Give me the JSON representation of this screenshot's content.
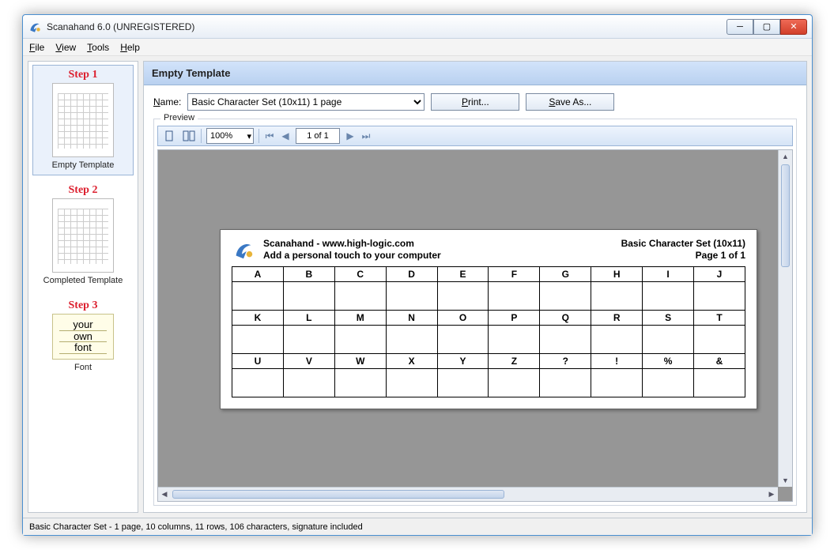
{
  "window": {
    "title": "Scanahand 6.0 (UNREGISTERED)"
  },
  "menubar": {
    "file": "File",
    "view": "View",
    "tools": "Tools",
    "help": "Help"
  },
  "sidebar": {
    "steps": [
      {
        "title": "Step 1",
        "label": "Empty Template"
      },
      {
        "title": "Step 2",
        "label": "Completed Template"
      },
      {
        "title": "Step 3",
        "label": "Font",
        "handwrite": [
          "your",
          "own",
          "font"
        ]
      }
    ]
  },
  "main": {
    "header": "Empty Template",
    "name_label": "Name:",
    "template_selected": "Basic Character Set (10x11) 1 page",
    "print": "Print...",
    "saveas": "Save As...",
    "preview_label": "Preview",
    "zoom": "100%",
    "page_indicator": "1 of 1"
  },
  "page": {
    "brand_line1": "Scanahand - www.high-logic.com",
    "brand_line2": "Add a personal touch to your computer",
    "set_name": "Basic Character Set (10x11)",
    "page_of": "Page 1 of 1",
    "rows": [
      [
        "A",
        "B",
        "C",
        "D",
        "E",
        "F",
        "G",
        "H",
        "I",
        "J"
      ],
      [
        "K",
        "L",
        "M",
        "N",
        "O",
        "P",
        "Q",
        "R",
        "S",
        "T"
      ],
      [
        "U",
        "V",
        "W",
        "X",
        "Y",
        "Z",
        "?",
        "!",
        "%",
        "&"
      ]
    ]
  },
  "status": "Basic Character Set - 1 page, 10 columns, 11 rows, 106 characters, signature included"
}
